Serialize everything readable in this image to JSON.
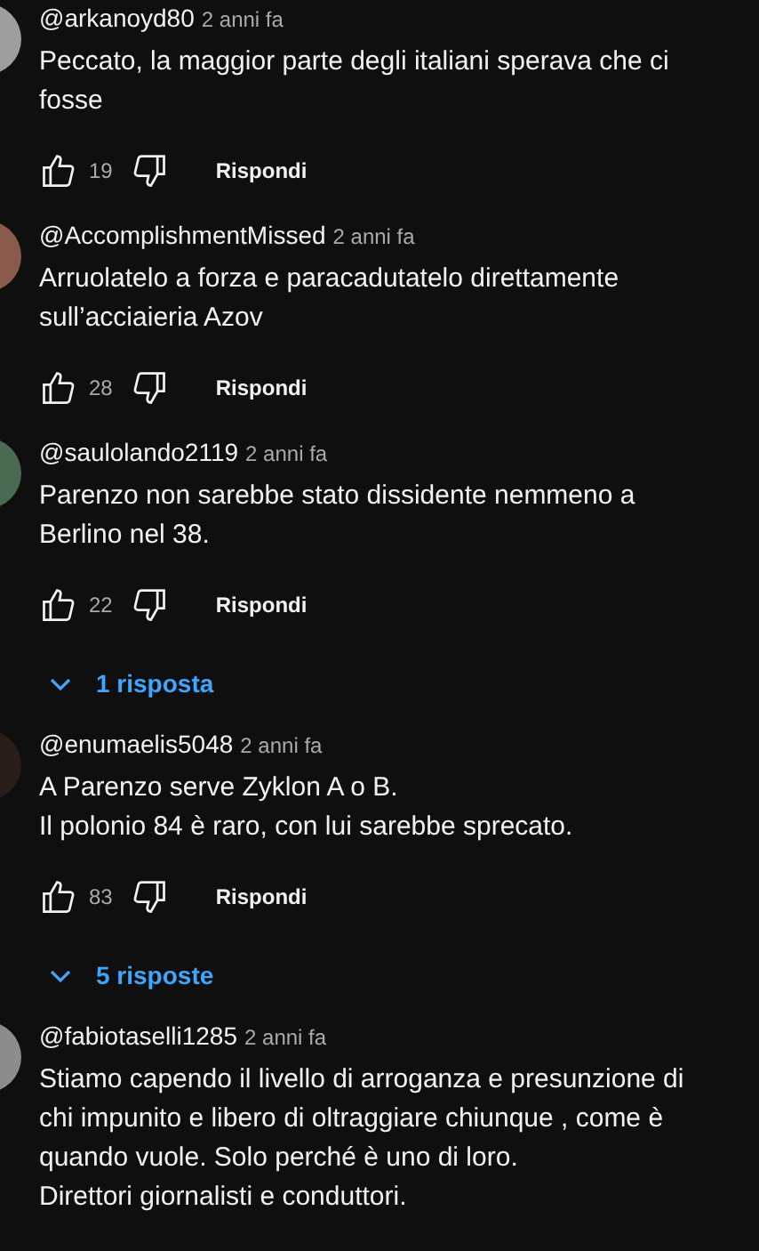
{
  "comments": [
    {
      "author": "@arkanoyd80",
      "time": "2 anni fa",
      "color": "#9e9e9e",
      "text": "Peccato, la maggior parte degli italiani sperava che ci fosse",
      "likes": "19",
      "reply_label": "Rispondi"
    },
    {
      "author": "@AccomplishmentMissed",
      "time": "2 anni fa",
      "color": "#8a5a4a",
      "text": "Arruolatelo a forza e paracadutatelo direttamente sull’acciaieria Azov",
      "likes": "28",
      "reply_label": "Rispondi"
    },
    {
      "author": "@saulolando2119",
      "time": "2 anni fa",
      "color": "#4a6a52",
      "text": "Parenzo non sarebbe stato dissidente nemmeno a Berlino nel 38.",
      "likes": "22",
      "reply_label": "Rispondi",
      "replies": "1 risposta"
    },
    {
      "author": "@enumaelis5048",
      "time": "2 anni fa",
      "color": "#2a1e1a",
      "text": "A Parenzo serve Zyklon A o B.\nIl polonio 84 è raro, con lui sarebbe sprecato.",
      "likes": "83",
      "reply_label": "Rispondi",
      "replies": "5 risposte"
    },
    {
      "author": "@fabiotaselli1285",
      "time": "2 anni fa",
      "color": "#8c8c8c",
      "text": "Stiamo capendo il livello di arroganza e presunzione di chi impunito e libero di oltraggiare chiunque , come è quando vuole. Solo perché è uno di loro.\nDirettori giornalisti e conduttori."
    }
  ]
}
